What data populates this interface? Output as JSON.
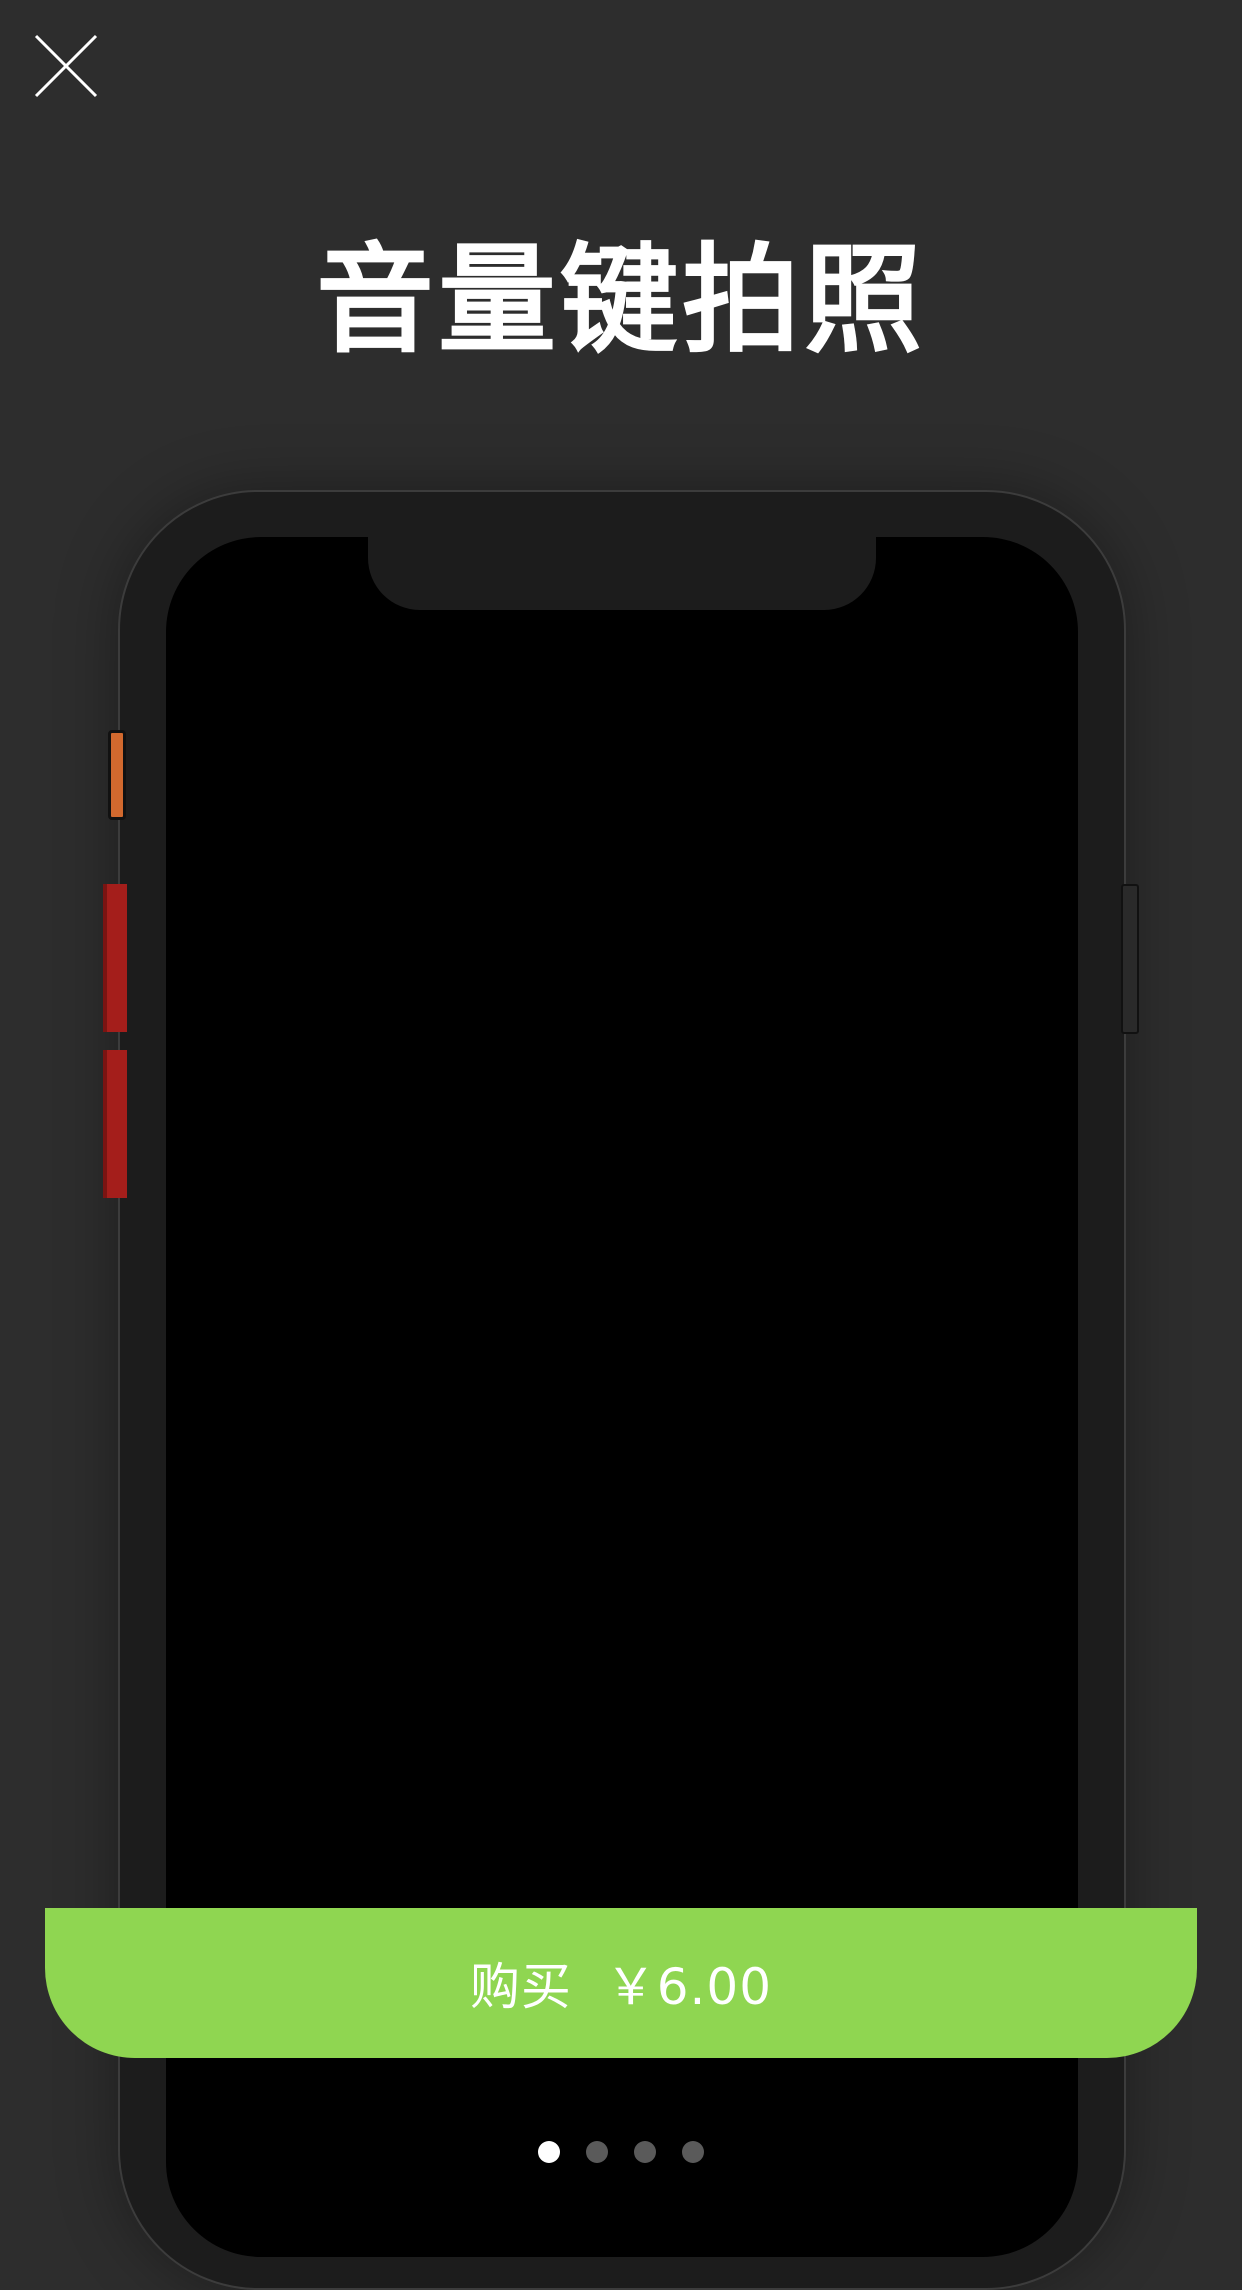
{
  "header": {
    "close_icon": "close-icon",
    "title": "音量键拍照"
  },
  "purchase": {
    "label": "购买  ￥6.00",
    "color": "#8fd651"
  },
  "pager": {
    "count": 4,
    "active_index": 0
  },
  "colors": {
    "background": "#2d2d2d",
    "phone_body": "#1c1c1c",
    "volume_buttons": "#a41e1b",
    "side_switch": "#d2692e"
  }
}
